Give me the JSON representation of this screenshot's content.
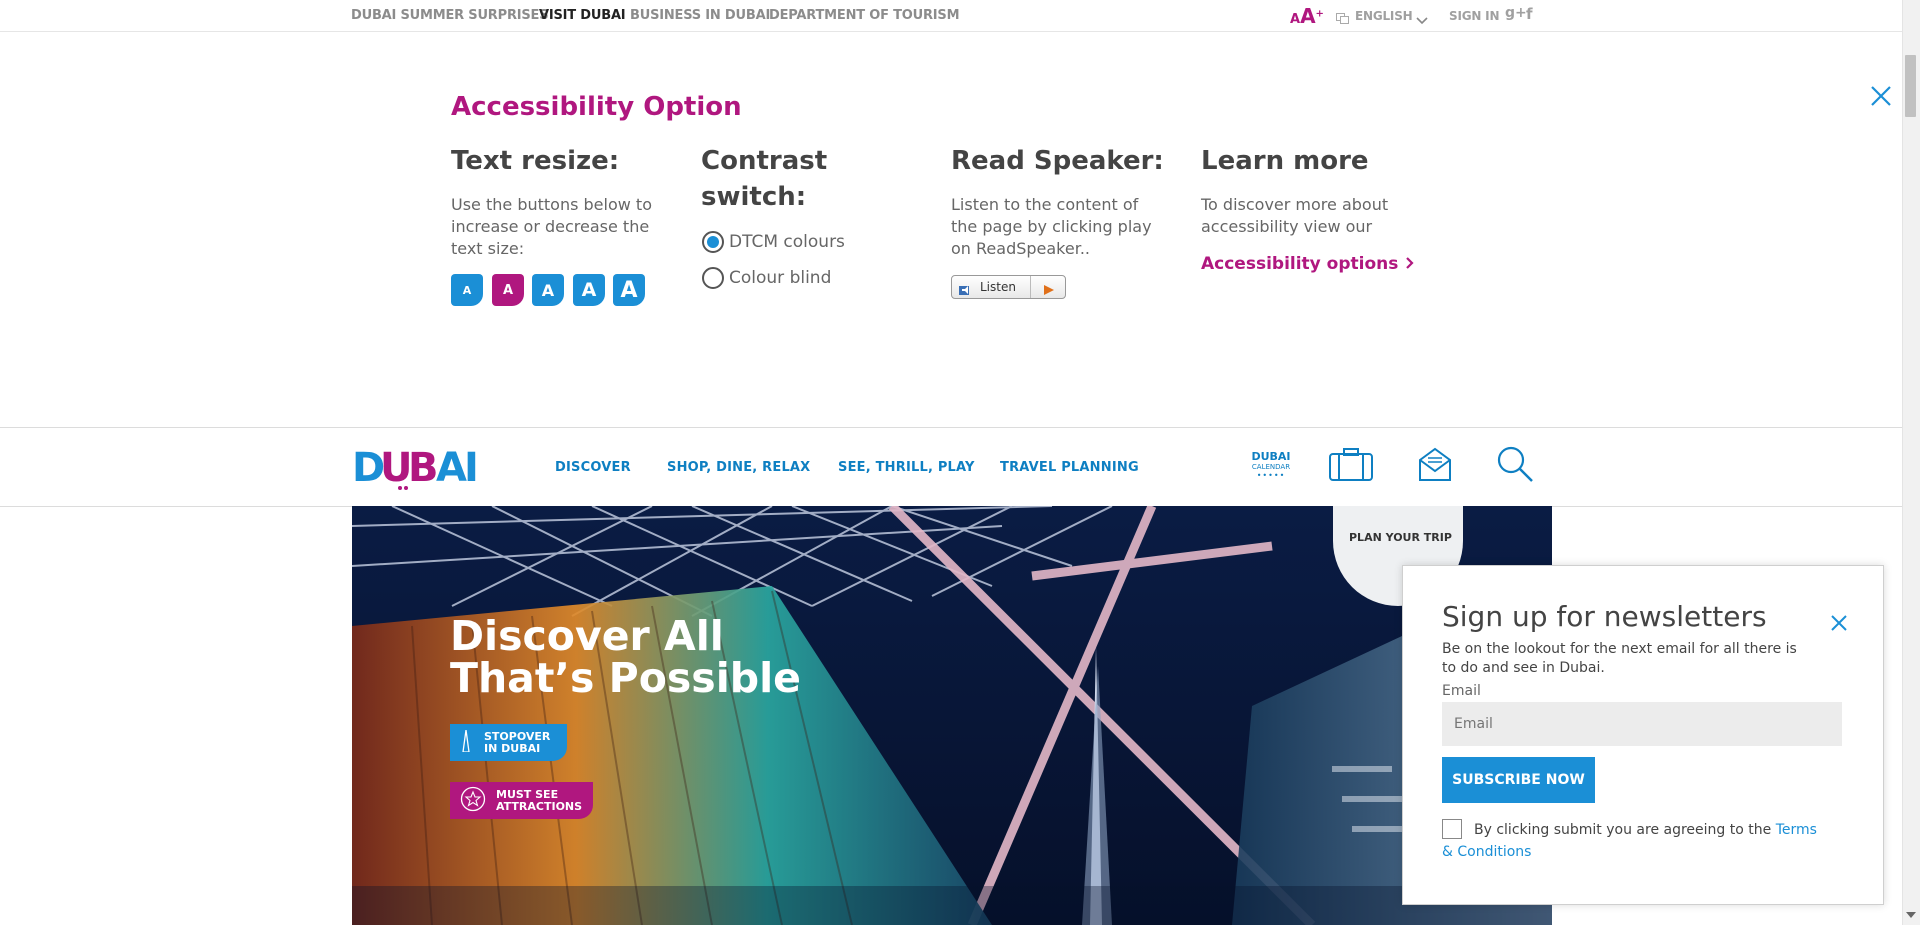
{
  "topbar": {
    "links": [
      "DUBAI SUMMER SURPRISES",
      "VISIT DUBAI",
      "BUSINESS IN DUBAI",
      "DEPARTMENT OF TOURISM"
    ],
    "font_small": "A",
    "font_large": "A",
    "font_plus": "+",
    "language": "ENGLISH",
    "sign_in": "SIGN IN",
    "gplus": "g+",
    "facebook": "f"
  },
  "accessibility": {
    "title": "Accessibility Option",
    "text_resize": {
      "heading": "Text resize:",
      "description": "Use the buttons below to increase or decrease the text size:",
      "buttons": [
        "A",
        "A",
        "A",
        "A",
        "A"
      ]
    },
    "contrast": {
      "heading_line1": "Contrast",
      "heading_line2": "switch:",
      "options": [
        "DTCM colours",
        "Colour blind"
      ]
    },
    "read_speaker": {
      "heading": "Read Speaker:",
      "description": "Listen to the content of the page by clicking play on ReadSpeaker..",
      "listen_label": "Listen"
    },
    "learn_more": {
      "heading": "Learn more",
      "description": "To discover more about accessibility view our",
      "link": "Accessibility options"
    }
  },
  "mainnav": {
    "logo": "DUBAI",
    "items": [
      "DISCOVER",
      "SHOP, DINE, RELAX",
      "SEE, THRILL, PLAY",
      "TRAVEL PLANNING"
    ],
    "calendar_line1": "DUBAI",
    "calendar_line2": "CALENDAR"
  },
  "hero": {
    "title_line1": "Discover All",
    "title_line2": "That’s Possible",
    "stopover_line1": "STOPOVER",
    "stopover_line2": "IN DUBAI",
    "mustsee_line1": "MUST SEE",
    "mustsee_line2": "ATTRACTIONS",
    "plan_trip": "PLAN YOUR TRIP"
  },
  "newsletter": {
    "title": "Sign up for newsletters",
    "description": "Be on the lookout for the next email for all there is to do and see in Dubai.",
    "email_label": "Email",
    "email_placeholder": "Email",
    "subscribe": "SUBSCRIBE NOW",
    "consent_text": "By clicking submit you are agreeing to the ",
    "terms_link": "Terms & Conditions"
  },
  "colors": {
    "brand_magenta": "#b0177f",
    "brand_blue": "#0e7fc2",
    "button_blue": "#1b8fd6"
  }
}
